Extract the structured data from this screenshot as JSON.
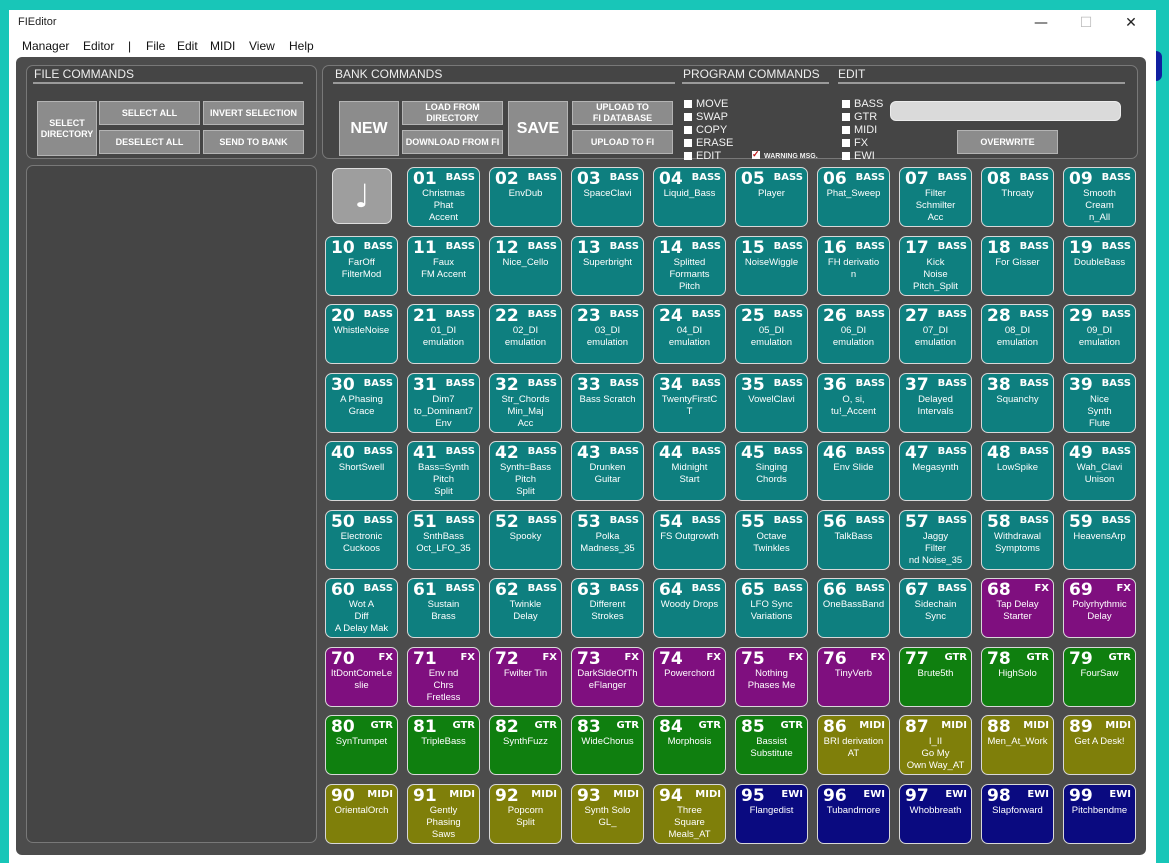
{
  "window": {
    "title": "FIEditor",
    "minimize": "—",
    "maximize": "☐",
    "close": "✕"
  },
  "menu": [
    "Manager",
    "Editor",
    "|",
    "File",
    "Edit",
    "MIDI",
    "View",
    "Help"
  ],
  "file_commands": {
    "title": "FILE COMMANDS",
    "select_directory": "SELECT\nDIRECTORY",
    "select_all": "SELECT ALL",
    "invert_selection": "INVERT SELECTION",
    "deselect_all": "DESELECT ALL",
    "send_to_bank": "SEND TO BANK"
  },
  "bank_commands": {
    "title": "BANK COMMANDS",
    "new": "NEW",
    "load_from_directory": "LOAD FROM\nDIRECTORY",
    "download_from_fi": "DOWNLOAD FROM FI",
    "save": "SAVE",
    "upload_to_fi_database": "UPLOAD TO\nFI DATABASE",
    "upload_to_fi": "UPLOAD TO FI"
  },
  "program_commands": {
    "title": "PROGRAM COMMANDS",
    "options": [
      "MOVE",
      "SWAP",
      "COPY",
      "ERASE",
      "EDIT"
    ],
    "warning": "WARNING MSG.",
    "warning_checked": true
  },
  "edit": {
    "title": "EDIT",
    "options": [
      "BASS",
      "GTR",
      "MIDI",
      "FX",
      "EWI"
    ],
    "field_value": "",
    "overwrite": "OVERWRITE"
  },
  "note_icon": "♩",
  "colors": {
    "BASS": "#0e7f7f",
    "FX": "#7f0f7f",
    "GTR": "#0f7f0f",
    "MIDI": "#7f7f0a",
    "EWI": "#0a0a80"
  },
  "programs": [
    {
      "num": "01",
      "cat": "BASS",
      "name": "Christmas\nPhat\nAccent"
    },
    {
      "num": "02",
      "cat": "BASS",
      "name": "EnvDub"
    },
    {
      "num": "03",
      "cat": "BASS",
      "name": "SpaceClavi"
    },
    {
      "num": "04",
      "cat": "BASS",
      "name": "Liquid_Bass"
    },
    {
      "num": "05",
      "cat": "BASS",
      "name": "Player"
    },
    {
      "num": "06",
      "cat": "BASS",
      "name": "Phat_Sweep"
    },
    {
      "num": "07",
      "cat": "BASS",
      "name": "Filter\nSchmilter\nAcc"
    },
    {
      "num": "08",
      "cat": "BASS",
      "name": "Throaty"
    },
    {
      "num": "09",
      "cat": "BASS",
      "name": "Smooth\nCream\nn_All"
    },
    {
      "num": "10",
      "cat": "BASS",
      "name": "FarOff\nFilterMod"
    },
    {
      "num": "11",
      "cat": "BASS",
      "name": "Faux\nFM Accent"
    },
    {
      "num": "12",
      "cat": "BASS",
      "name": "Nice_Cello"
    },
    {
      "num": "13",
      "cat": "BASS",
      "name": "Superbright"
    },
    {
      "num": "14",
      "cat": "BASS",
      "name": "Splitted\nFormants\nPitch"
    },
    {
      "num": "15",
      "cat": "BASS",
      "name": "NoiseWiggle"
    },
    {
      "num": "16",
      "cat": "BASS",
      "name": "FH derivatio\nn"
    },
    {
      "num": "17",
      "cat": "BASS",
      "name": "Kick\nNoise\nPitch_Split"
    },
    {
      "num": "18",
      "cat": "BASS",
      "name": "For Gisser"
    },
    {
      "num": "19",
      "cat": "BASS",
      "name": "DoubleBass"
    },
    {
      "num": "20",
      "cat": "BASS",
      "name": "WhistleNoise"
    },
    {
      "num": "21",
      "cat": "BASS",
      "name": "01_DI\nemulation"
    },
    {
      "num": "22",
      "cat": "BASS",
      "name": "02_DI\nemulation"
    },
    {
      "num": "23",
      "cat": "BASS",
      "name": "03_DI\nemulation"
    },
    {
      "num": "24",
      "cat": "BASS",
      "name": "04_DI\nemulation"
    },
    {
      "num": "25",
      "cat": "BASS",
      "name": "05_DI\nemulation"
    },
    {
      "num": "26",
      "cat": "BASS",
      "name": "06_DI\nemulation"
    },
    {
      "num": "27",
      "cat": "BASS",
      "name": "07_DI\nemulation"
    },
    {
      "num": "28",
      "cat": "BASS",
      "name": "08_DI\nemulation"
    },
    {
      "num": "29",
      "cat": "BASS",
      "name": "09_DI\nemulation"
    },
    {
      "num": "30",
      "cat": "BASS",
      "name": "A Phasing\nGrace"
    },
    {
      "num": "31",
      "cat": "BASS",
      "name": "Dim7\nto_Dominant7\nEnv"
    },
    {
      "num": "32",
      "cat": "BASS",
      "name": "Str_Chords\nMin_Maj\nAcc"
    },
    {
      "num": "33",
      "cat": "BASS",
      "name": "Bass Scratch"
    },
    {
      "num": "34",
      "cat": "BASS",
      "name": "TwentyFirstC\nT"
    },
    {
      "num": "35",
      "cat": "BASS",
      "name": "VowelClavi"
    },
    {
      "num": "36",
      "cat": "BASS",
      "name": "O, si,\ntu!_Accent"
    },
    {
      "num": "37",
      "cat": "BASS",
      "name": "Delayed\nIntervals"
    },
    {
      "num": "38",
      "cat": "BASS",
      "name": "Squanchy"
    },
    {
      "num": "39",
      "cat": "BASS",
      "name": "Nice\nSynth\nFlute"
    },
    {
      "num": "40",
      "cat": "BASS",
      "name": "ShortSwell"
    },
    {
      "num": "41",
      "cat": "BASS",
      "name": "Bass=Synth\nPitch\nSplit"
    },
    {
      "num": "42",
      "cat": "BASS",
      "name": "Synth=Bass\nPitch\nSplit"
    },
    {
      "num": "43",
      "cat": "BASS",
      "name": "Drunken\nGuitar"
    },
    {
      "num": "44",
      "cat": "BASS",
      "name": "Midnight\nStart"
    },
    {
      "num": "45",
      "cat": "BASS",
      "name": "Singing\nChords"
    },
    {
      "num": "46",
      "cat": "BASS",
      "name": "Env Slide"
    },
    {
      "num": "47",
      "cat": "BASS",
      "name": "Megasynth"
    },
    {
      "num": "48",
      "cat": "BASS",
      "name": "LowSpike"
    },
    {
      "num": "49",
      "cat": "BASS",
      "name": "Wah_Clavi\nUnison"
    },
    {
      "num": "50",
      "cat": "BASS",
      "name": "Electronic\nCuckoos"
    },
    {
      "num": "51",
      "cat": "BASS",
      "name": "SnthBass\nOct_LFO_35"
    },
    {
      "num": "52",
      "cat": "BASS",
      "name": "Spooky"
    },
    {
      "num": "53",
      "cat": "BASS",
      "name": "Polka\nMadness_35"
    },
    {
      "num": "54",
      "cat": "BASS",
      "name": "FS Outgrowth"
    },
    {
      "num": "55",
      "cat": "BASS",
      "name": "Octave\nTwinkles"
    },
    {
      "num": "56",
      "cat": "BASS",
      "name": "TalkBass"
    },
    {
      "num": "57",
      "cat": "BASS",
      "name": "Jaggy\nFilter\nnd Noise_35"
    },
    {
      "num": "58",
      "cat": "BASS",
      "name": "Withdrawal\nSymptoms"
    },
    {
      "num": "59",
      "cat": "BASS",
      "name": "HeavensArp"
    },
    {
      "num": "60",
      "cat": "BASS",
      "name": "Wot A\nDiff\nA Delay Mak"
    },
    {
      "num": "61",
      "cat": "BASS",
      "name": "Sustain\nBrass"
    },
    {
      "num": "62",
      "cat": "BASS",
      "name": "Twinkle\nDelay"
    },
    {
      "num": "63",
      "cat": "BASS",
      "name": "Different\nStrokes"
    },
    {
      "num": "64",
      "cat": "BASS",
      "name": "Woody Drops"
    },
    {
      "num": "65",
      "cat": "BASS",
      "name": "LFO Sync\nVariations"
    },
    {
      "num": "66",
      "cat": "BASS",
      "name": "OneBassBand"
    },
    {
      "num": "67",
      "cat": "BASS",
      "name": "Sidechain\nSync"
    },
    {
      "num": "68",
      "cat": "FX",
      "name": "Tap Delay\nStarter"
    },
    {
      "num": "69",
      "cat": "FX",
      "name": "Polyrhythmic\nDelay"
    },
    {
      "num": "70",
      "cat": "FX",
      "name": "ItDontComeLe\nslie"
    },
    {
      "num": "71",
      "cat": "FX",
      "name": "Env nd\nChrs\nFretless"
    },
    {
      "num": "72",
      "cat": "FX",
      "name": "Fwilter Tin"
    },
    {
      "num": "73",
      "cat": "FX",
      "name": "DarkSldeOfTh\neFlanger"
    },
    {
      "num": "74",
      "cat": "FX",
      "name": "Powerchord"
    },
    {
      "num": "75",
      "cat": "FX",
      "name": "Nothing\nPhases Me"
    },
    {
      "num": "76",
      "cat": "FX",
      "name": "TinyVerb"
    },
    {
      "num": "77",
      "cat": "GTR",
      "name": "Brute5th"
    },
    {
      "num": "78",
      "cat": "GTR",
      "name": "HighSolo"
    },
    {
      "num": "79",
      "cat": "GTR",
      "name": "FourSaw"
    },
    {
      "num": "80",
      "cat": "GTR",
      "name": "SynTrumpet"
    },
    {
      "num": "81",
      "cat": "GTR",
      "name": "TripleBass"
    },
    {
      "num": "82",
      "cat": "GTR",
      "name": "SynthFuzz"
    },
    {
      "num": "83",
      "cat": "GTR",
      "name": "WideChorus"
    },
    {
      "num": "84",
      "cat": "GTR",
      "name": "Morphosis"
    },
    {
      "num": "85",
      "cat": "GTR",
      "name": "Bassist\nSubstitute"
    },
    {
      "num": "86",
      "cat": "MIDI",
      "name": "BRI derivation\nAT"
    },
    {
      "num": "87",
      "cat": "MIDI",
      "name": "I_II\nGo My\nOwn Way_AT"
    },
    {
      "num": "88",
      "cat": "MIDI",
      "name": "Men_At_Work"
    },
    {
      "num": "89",
      "cat": "MIDI",
      "name": "Get A Desk!"
    },
    {
      "num": "90",
      "cat": "MIDI",
      "name": "OrientalOrch"
    },
    {
      "num": "91",
      "cat": "MIDI",
      "name": "Gently\nPhasing\nSaws"
    },
    {
      "num": "92",
      "cat": "MIDI",
      "name": "Popcorn\nSplit"
    },
    {
      "num": "93",
      "cat": "MIDI",
      "name": "Synth Solo\nGL_"
    },
    {
      "num": "94",
      "cat": "MIDI",
      "name": "Three\nSquare\nMeals_AT"
    },
    {
      "num": "95",
      "cat": "EWI",
      "name": "Flangedist"
    },
    {
      "num": "96",
      "cat": "EWI",
      "name": "Tubandmore"
    },
    {
      "num": "97",
      "cat": "EWI",
      "name": "Whobbreath"
    },
    {
      "num": "98",
      "cat": "EWI",
      "name": "Slapforward"
    },
    {
      "num": "99",
      "cat": "EWI",
      "name": "Pitchbendme"
    }
  ]
}
